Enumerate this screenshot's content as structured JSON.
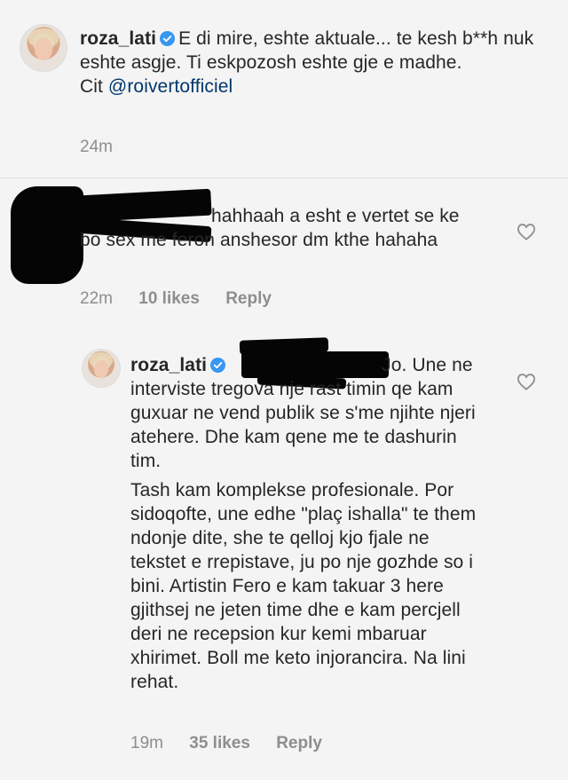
{
  "comments": [
    {
      "username": "roza_lati",
      "text": "E di mire, eshte aktuale... te kesh b**h nuk eshte asgje. Ti eskpozosh eshte gje e madhe.",
      "cite_prefix": "Cit",
      "mention": "@roivertofficiel",
      "time": "24m"
    },
    {
      "username": "",
      "text": "hahhaah a esht e vertet se ke bo sex me feron anshesor  dm kthe hahaha",
      "time": "22m",
      "likes": "10 likes",
      "reply": "Reply"
    },
    {
      "username": "roza_lati",
      "text_first": "Jo. Une ne interviste tregova nje rast timin qe kam guxuar ne vend publik se s'me njihte njeri atehere. Dhe kam qene me te dashurin tim.",
      "text_second": "Tash kam komplekse profesionale. Por sidoqofte, une edhe \"plaç ishalla\" te them ndonje dite, she te qelloj kjo fjale ne tekstet e rrepistave, ju po nje gozhde so i bini. Artistin Fero e kam takuar 3 here gjithsej ne jeten time dhe e kam percjell deri ne recepsion kur kemi mbaruar xhirimet. Boll me keto injorancira. Na lini rehat.",
      "time": "19m",
      "likes": "35 likes",
      "reply": "Reply"
    }
  ],
  "colors": {
    "background": "#f4f4f4",
    "text": "#262626",
    "meta": "#8e8e8e",
    "mention": "#00376b",
    "verified": "#3897f0"
  },
  "icons": [
    "verified-badge-icon",
    "heart-icon"
  ]
}
